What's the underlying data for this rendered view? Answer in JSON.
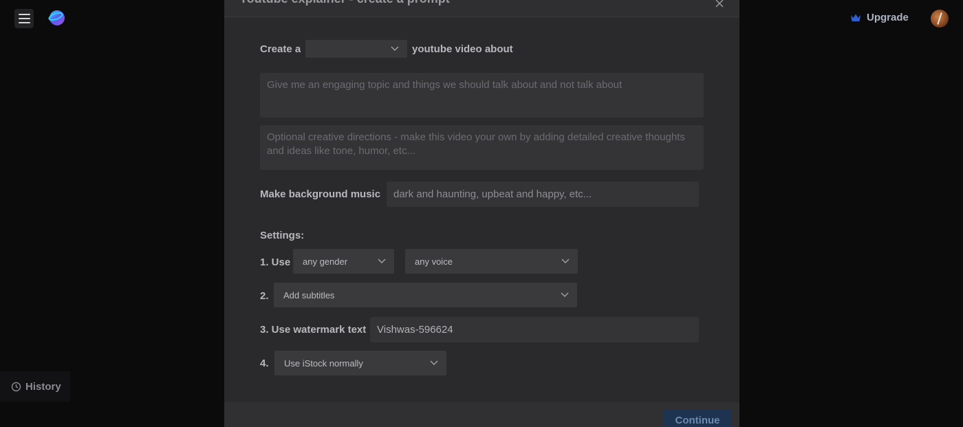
{
  "app": {
    "upgrade_label": "Upgrade",
    "history_label": "History"
  },
  "modal": {
    "title": "Youtube explainer - create a prompt",
    "create_prefix": "Create a",
    "video_type": {
      "selected": ""
    },
    "create_suffix": "youtube video about",
    "topic_placeholder": "Give me an engaging topic and things we should talk about and not talk about",
    "directions_placeholder": "Optional creative directions - make this video your own by adding detailed creative thoughts and ideas like tone, humor, etc...",
    "music_label": "Make background music",
    "music_placeholder": "dark and haunting, upbeat and happy, etc...",
    "settings_label": "Settings:",
    "setting1_label": "1. Use",
    "gender_selected": "any gender",
    "voice_selected": "any voice",
    "setting2_label": "2.",
    "subtitles_selected": "Add subtitles",
    "setting3_label": "3. Use watermark text",
    "watermark_value": "Vishwas-596624",
    "setting4_label": "4.",
    "istock_selected": "Use iStock normally",
    "continue_label": "Continue"
  },
  "colors": {
    "accent": "#1d3350",
    "background": "#0b0b0c",
    "modal": "#2a2a2c"
  }
}
